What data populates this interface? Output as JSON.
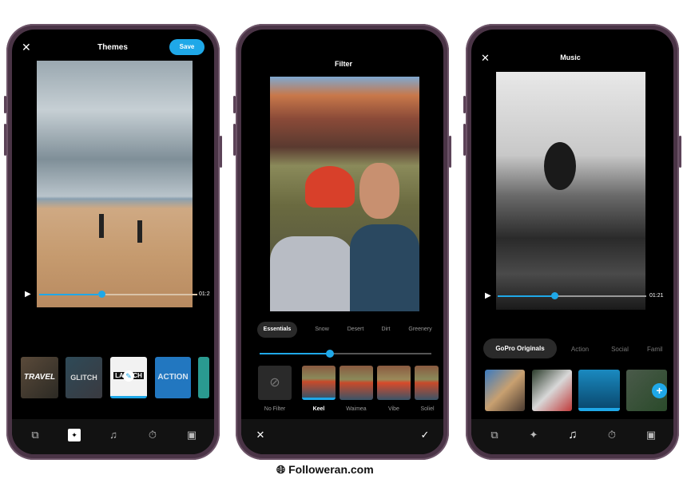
{
  "themes_screen": {
    "title": "Themes",
    "save_label": "Save",
    "time": "01:2",
    "progress_percent": 37,
    "themes": [
      "TRAVEL",
      "GLITCH",
      "LAUNCH",
      "ACTION"
    ],
    "selected_theme": "LAUNCH",
    "nav_active": "themes"
  },
  "filter_screen": {
    "title": "Filter",
    "categories": [
      "Essentials",
      "Snow",
      "Desert",
      "Dirt",
      "Greenery"
    ],
    "selected_category": "Essentials",
    "intensity_percent": 41,
    "filters": [
      "No Filter",
      "Keel",
      "Waimea",
      "Vibe",
      "Soliel"
    ],
    "selected_filter": "Keel"
  },
  "music_screen": {
    "title": "Music",
    "time": "01:21",
    "progress_percent": 38,
    "categories": [
      "GoPro Originals",
      "Action",
      "Social",
      "Famil"
    ],
    "selected_category": "GoPro Originals",
    "nav_active": "music"
  },
  "watermark": "Followeran.com",
  "colors": {
    "accent": "#1fa8e8",
    "phone_frame": "#4a3446"
  }
}
